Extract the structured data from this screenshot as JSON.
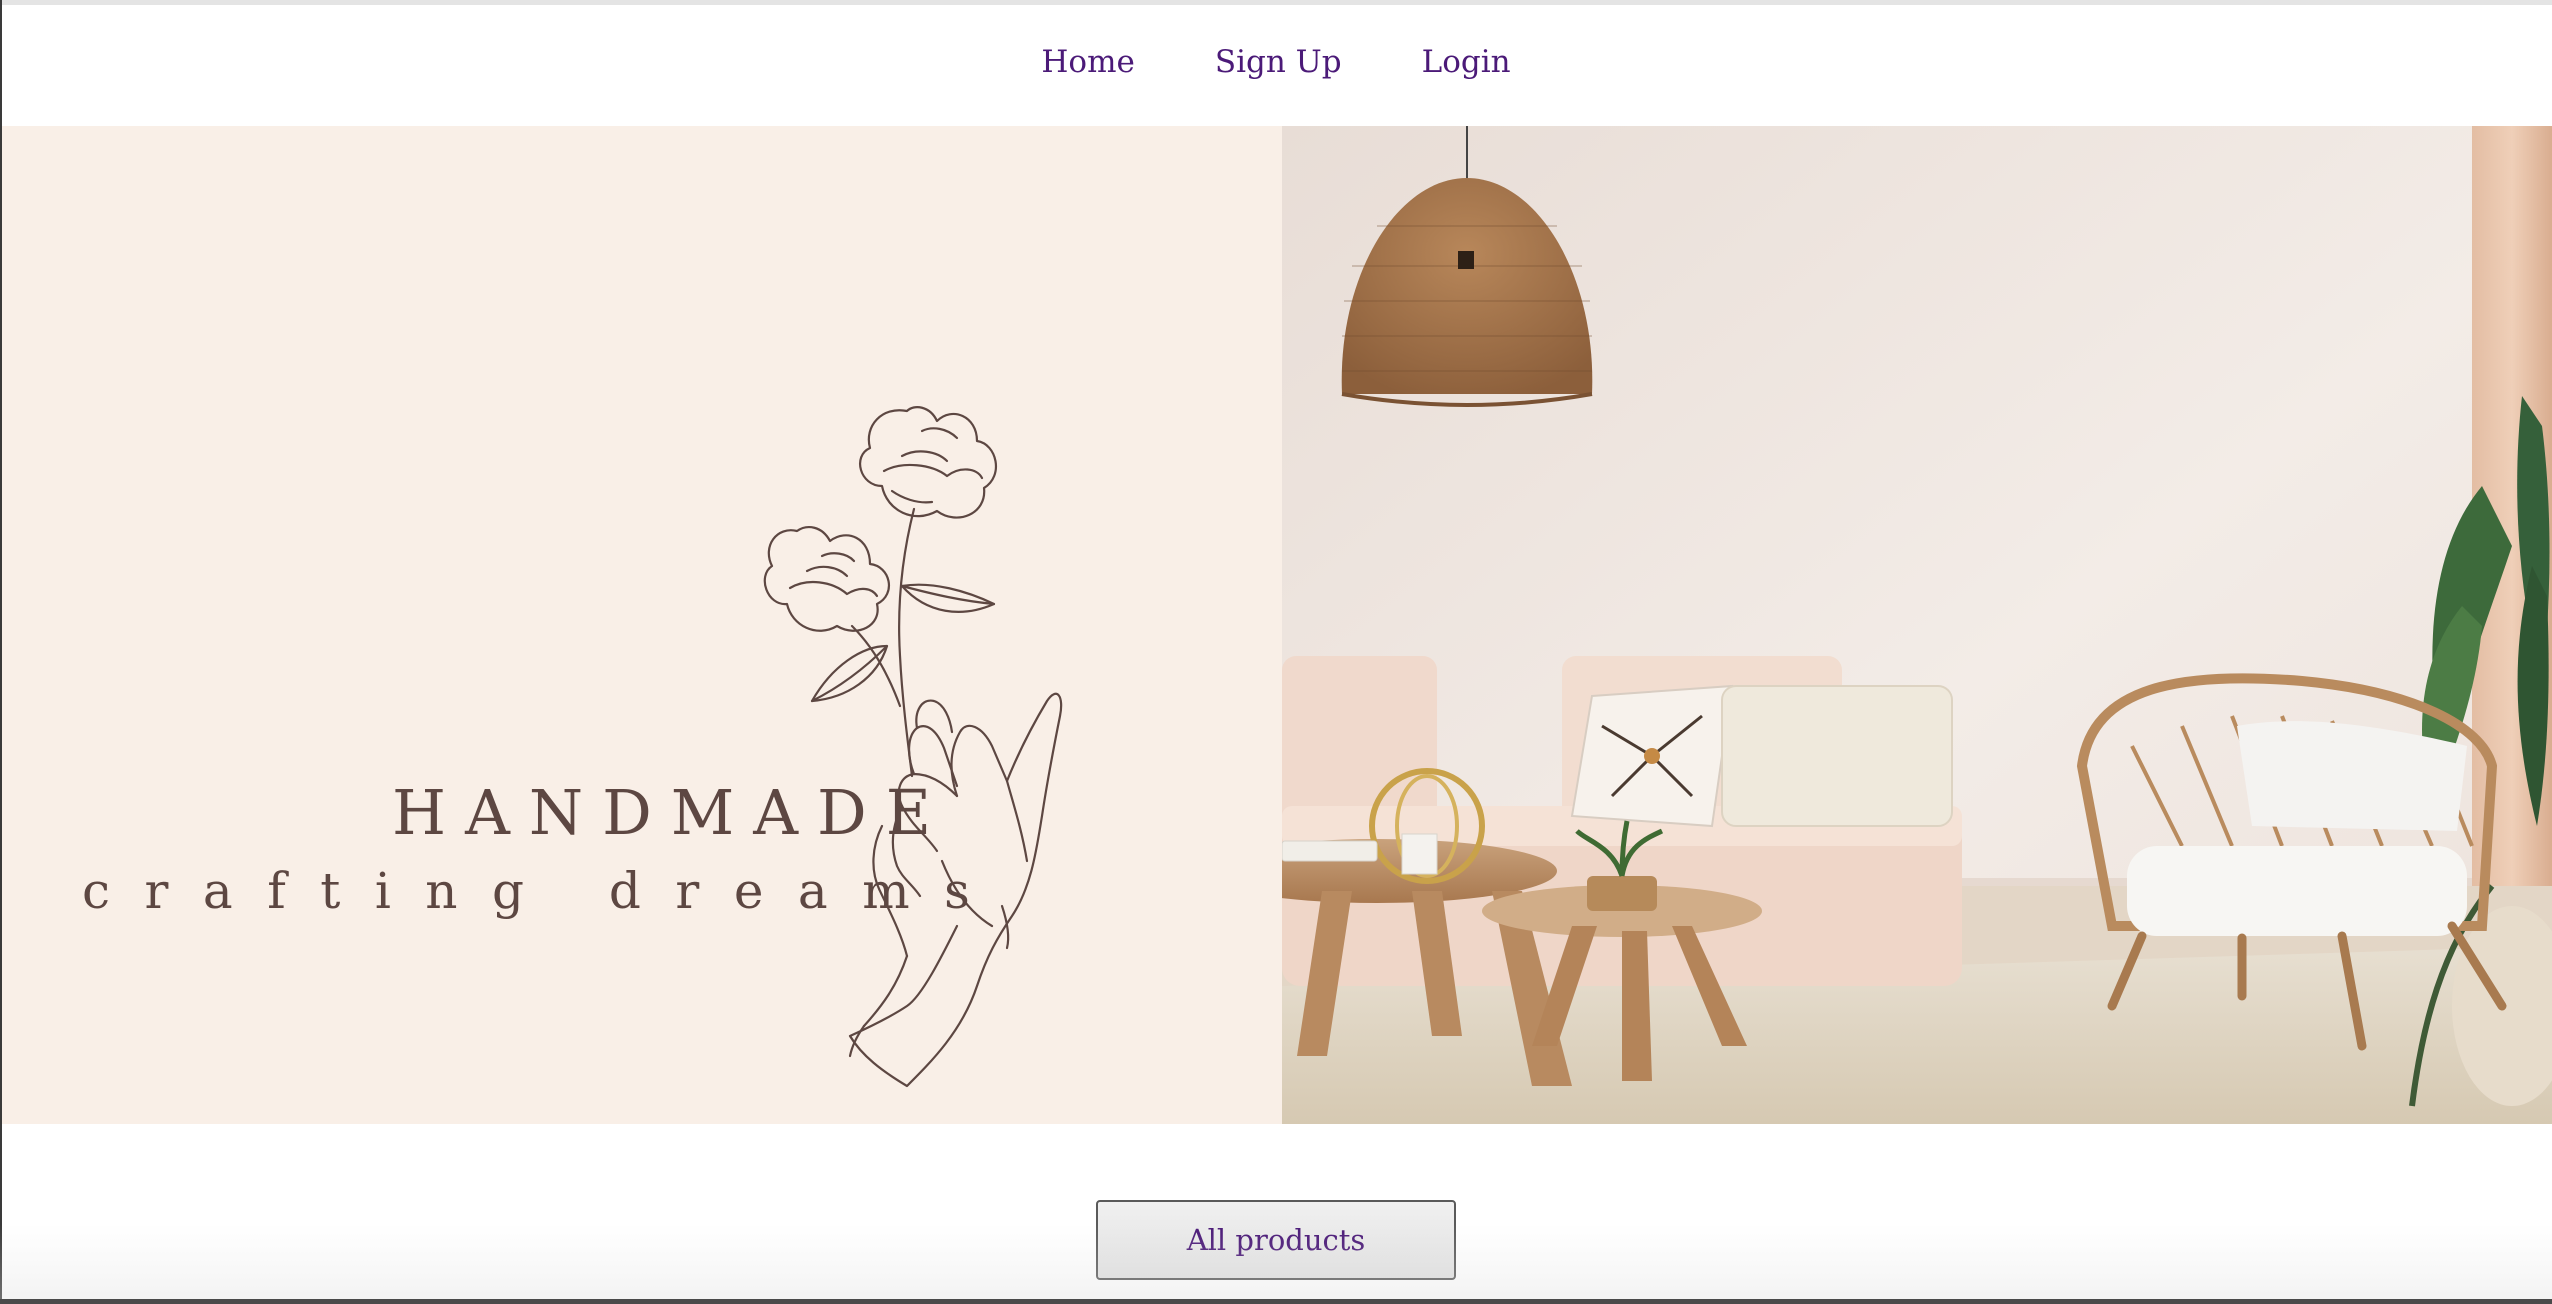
{
  "nav": {
    "items": [
      {
        "label": "Home"
      },
      {
        "label": "Sign Up"
      },
      {
        "label": "Login"
      }
    ]
  },
  "hero": {
    "brand_title": "HANDMADE",
    "brand_subtitle": "crafting dreams",
    "logo_icon": "flower-hand-icon",
    "photo": "living-room-photo"
  },
  "cta": {
    "label": "All products"
  },
  "colors": {
    "accent": "#4b1a78",
    "hero_bg": "#f9efe7",
    "logo_ink": "#5d4742"
  }
}
